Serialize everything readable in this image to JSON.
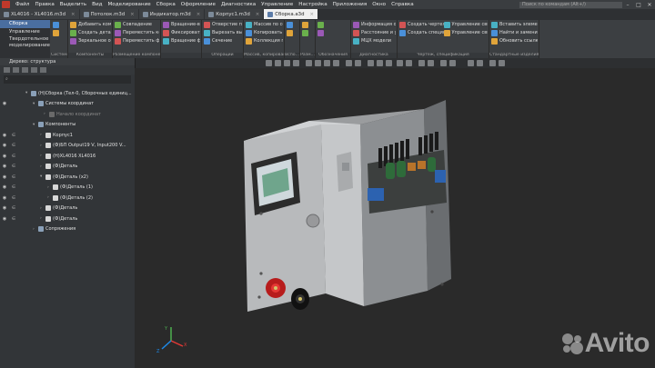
{
  "menu": [
    "Файл",
    "Правка",
    "Выделить",
    "Вид",
    "Моделирование",
    "Сборка",
    "Оформление",
    "Диагностика",
    "Управление",
    "Настройка",
    "Приложения",
    "Окно",
    "Справка"
  ],
  "search_placeholder": "Поиск по командам (Alt+/)",
  "tabs": [
    {
      "label": "XL4016 - XL4016.m3d",
      "active": false
    },
    {
      "label": "Потолок.m3d",
      "active": false
    },
    {
      "label": "Индикатор.m3d",
      "active": false
    },
    {
      "label": "Корпус1.m3d",
      "active": false
    },
    {
      "label": "Сборка.a3d",
      "active": true
    }
  ],
  "ribbon_left": [
    "Сборка",
    "Управление",
    "Твердотельное моделирование"
  ],
  "ribbon_groups": [
    {
      "label": "Системная",
      "buttons": [
        "",
        ""
      ]
    },
    {
      "label": "Компоненты",
      "buttons": [
        "Добавить компонент из...",
        "Создать деталь",
        "Зеркальное отражение..."
      ]
    },
    {
      "label": "Размещение компонентов",
      "buttons": [
        "Совпадение",
        "Переместить компонент",
        "Переместить фиксацию"
      ]
    },
    {
      "label": "",
      "buttons": [
        "Вращение-вращение",
        "Фиксировать",
        "Вращение фиксации"
      ]
    },
    {
      "label": "Операции",
      "buttons": [
        "Отверстие простое",
        "Вырезать выдавливанием",
        "Сечение"
      ]
    },
    {
      "label": "Массив, копирование",
      "buttons": [
        "Массив по сетке",
        "Копировать объекты",
        "Коллекция геометрии"
      ]
    },
    {
      "label": "Вспо...",
      "buttons": [
        "",
        ""
      ]
    },
    {
      "label": "Разм...",
      "buttons": [
        "",
        ""
      ]
    },
    {
      "label": "Обозначения",
      "buttons": [
        "",
        ""
      ]
    },
    {
      "label": "Диагностика",
      "buttons": [
        "Информация об объекте",
        "Расстояние и угол",
        "МЦХ модели"
      ]
    },
    {
      "label": "Чертеж, спецификация",
      "buttons": [
        "Создать чертеж по модели",
        "Управление связанными ч...",
        "Создать спецификацию",
        "Управление связанными с..."
      ]
    },
    {
      "label": "Стандартные изделия",
      "buttons": [
        "Вставить элемент",
        "Найти и заменить",
        "Обновить ссылки на изд..."
      ]
    }
  ],
  "tree": {
    "title": "Дерево: структура",
    "search_placeholder": "",
    "rows": [
      {
        "label": "(Н)Сборка (Тел-0, Сборочных единиц...",
        "indent": 28,
        "eye": "",
        "link": "",
        "dim": false,
        "color": "#8aa0b8",
        "chev": "▾"
      },
      {
        "label": "Системы координат",
        "indent": 36,
        "eye": "👁",
        "link": "",
        "dim": false,
        "color": "#8aa0b8",
        "chev": "▾"
      },
      {
        "label": "Начало координат",
        "indent": 48,
        "eye": "",
        "link": "",
        "dim": true,
        "color": "#6a6a6a",
        "chev": "›"
      },
      {
        "label": "Компоненты",
        "indent": 36,
        "eye": "",
        "link": "",
        "dim": false,
        "color": "#8aa0b8",
        "chev": "▾"
      },
      {
        "label": "Корпус1",
        "indent": 44,
        "eye": "👁",
        "link": "∈",
        "dim": false,
        "color": "#d8d8d8",
        "chev": "›"
      },
      {
        "label": "(Ф)БП Output19 V, Input200 V...",
        "indent": 44,
        "eye": "👁",
        "link": "∈",
        "dim": false,
        "color": "#d8d8d8",
        "chev": "›"
      },
      {
        "label": "(Н)XL4016 XL4016",
        "indent": 44,
        "eye": "👁",
        "link": "∈",
        "dim": false,
        "color": "#d8d8d8",
        "chev": "›"
      },
      {
        "label": "(Ф)Деталь",
        "indent": 44,
        "eye": "👁",
        "link": "∈",
        "dim": false,
        "color": "#d8d8d8",
        "chev": "›"
      },
      {
        "label": "(Ф)Деталь (x2)",
        "indent": 44,
        "eye": "👁",
        "link": "∈",
        "dim": false,
        "color": "#d8d8d8",
        "chev": "▾"
      },
      {
        "label": "(Ф)Деталь (1)",
        "indent": 52,
        "eye": "👁",
        "link": "∈",
        "dim": false,
        "color": "#d8d8d8",
        "chev": "›"
      },
      {
        "label": "(Ф)Деталь (2)",
        "indent": 52,
        "eye": "👁",
        "link": "∈",
        "dim": false,
        "color": "#d8d8d8",
        "chev": "›"
      },
      {
        "label": "(Ф)Деталь",
        "indent": 44,
        "eye": "👁",
        "link": "∈",
        "dim": false,
        "color": "#d8d8d8",
        "chev": "›"
      },
      {
        "label": "(Ф)Деталь",
        "indent": 44,
        "eye": "👁",
        "link": "∈",
        "dim": false,
        "color": "#d8d8d8",
        "chev": "›"
      },
      {
        "label": "Сопряжения",
        "indent": 36,
        "eye": "",
        "link": "",
        "dim": false,
        "color": "#8aa0b8",
        "chev": "›"
      }
    ]
  },
  "watermark": "Avito",
  "axis_labels": {
    "x": "X",
    "y": "Y",
    "z": "Z"
  }
}
